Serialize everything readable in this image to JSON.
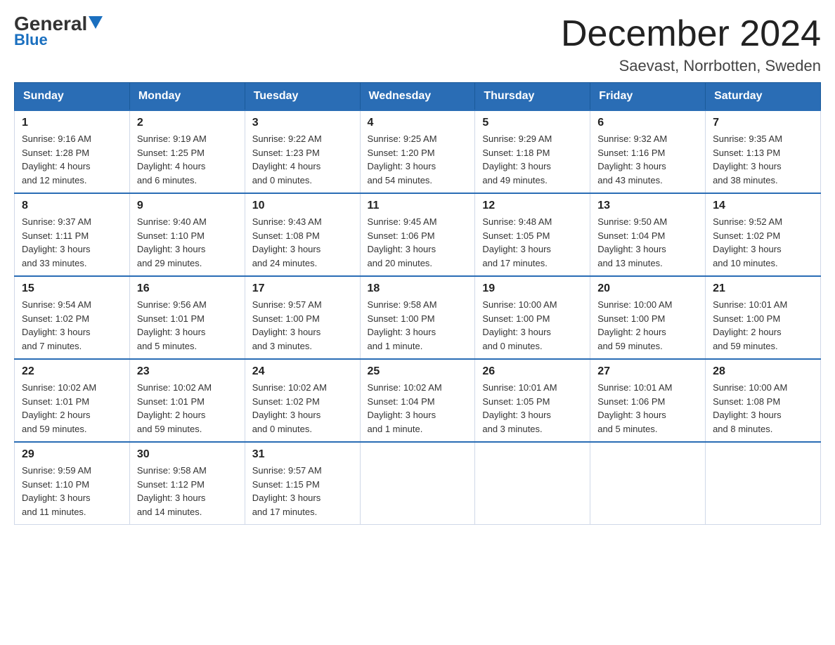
{
  "logo": {
    "general": "General",
    "blue": "Blue"
  },
  "title": "December 2024",
  "subtitle": "Saevast, Norrbotten, Sweden",
  "weekdays": [
    "Sunday",
    "Monday",
    "Tuesday",
    "Wednesday",
    "Thursday",
    "Friday",
    "Saturday"
  ],
  "weeks": [
    [
      {
        "day": "1",
        "info": "Sunrise: 9:16 AM\nSunset: 1:28 PM\nDaylight: 4 hours\nand 12 minutes."
      },
      {
        "day": "2",
        "info": "Sunrise: 9:19 AM\nSunset: 1:25 PM\nDaylight: 4 hours\nand 6 minutes."
      },
      {
        "day": "3",
        "info": "Sunrise: 9:22 AM\nSunset: 1:23 PM\nDaylight: 4 hours\nand 0 minutes."
      },
      {
        "day": "4",
        "info": "Sunrise: 9:25 AM\nSunset: 1:20 PM\nDaylight: 3 hours\nand 54 minutes."
      },
      {
        "day": "5",
        "info": "Sunrise: 9:29 AM\nSunset: 1:18 PM\nDaylight: 3 hours\nand 49 minutes."
      },
      {
        "day": "6",
        "info": "Sunrise: 9:32 AM\nSunset: 1:16 PM\nDaylight: 3 hours\nand 43 minutes."
      },
      {
        "day": "7",
        "info": "Sunrise: 9:35 AM\nSunset: 1:13 PM\nDaylight: 3 hours\nand 38 minutes."
      }
    ],
    [
      {
        "day": "8",
        "info": "Sunrise: 9:37 AM\nSunset: 1:11 PM\nDaylight: 3 hours\nand 33 minutes."
      },
      {
        "day": "9",
        "info": "Sunrise: 9:40 AM\nSunset: 1:10 PM\nDaylight: 3 hours\nand 29 minutes."
      },
      {
        "day": "10",
        "info": "Sunrise: 9:43 AM\nSunset: 1:08 PM\nDaylight: 3 hours\nand 24 minutes."
      },
      {
        "day": "11",
        "info": "Sunrise: 9:45 AM\nSunset: 1:06 PM\nDaylight: 3 hours\nand 20 minutes."
      },
      {
        "day": "12",
        "info": "Sunrise: 9:48 AM\nSunset: 1:05 PM\nDaylight: 3 hours\nand 17 minutes."
      },
      {
        "day": "13",
        "info": "Sunrise: 9:50 AM\nSunset: 1:04 PM\nDaylight: 3 hours\nand 13 minutes."
      },
      {
        "day": "14",
        "info": "Sunrise: 9:52 AM\nSunset: 1:02 PM\nDaylight: 3 hours\nand 10 minutes."
      }
    ],
    [
      {
        "day": "15",
        "info": "Sunrise: 9:54 AM\nSunset: 1:02 PM\nDaylight: 3 hours\nand 7 minutes."
      },
      {
        "day": "16",
        "info": "Sunrise: 9:56 AM\nSunset: 1:01 PM\nDaylight: 3 hours\nand 5 minutes."
      },
      {
        "day": "17",
        "info": "Sunrise: 9:57 AM\nSunset: 1:00 PM\nDaylight: 3 hours\nand 3 minutes."
      },
      {
        "day": "18",
        "info": "Sunrise: 9:58 AM\nSunset: 1:00 PM\nDaylight: 3 hours\nand 1 minute."
      },
      {
        "day": "19",
        "info": "Sunrise: 10:00 AM\nSunset: 1:00 PM\nDaylight: 3 hours\nand 0 minutes."
      },
      {
        "day": "20",
        "info": "Sunrise: 10:00 AM\nSunset: 1:00 PM\nDaylight: 2 hours\nand 59 minutes."
      },
      {
        "day": "21",
        "info": "Sunrise: 10:01 AM\nSunset: 1:00 PM\nDaylight: 2 hours\nand 59 minutes."
      }
    ],
    [
      {
        "day": "22",
        "info": "Sunrise: 10:02 AM\nSunset: 1:01 PM\nDaylight: 2 hours\nand 59 minutes."
      },
      {
        "day": "23",
        "info": "Sunrise: 10:02 AM\nSunset: 1:01 PM\nDaylight: 2 hours\nand 59 minutes."
      },
      {
        "day": "24",
        "info": "Sunrise: 10:02 AM\nSunset: 1:02 PM\nDaylight: 3 hours\nand 0 minutes."
      },
      {
        "day": "25",
        "info": "Sunrise: 10:02 AM\nSunset: 1:04 PM\nDaylight: 3 hours\nand 1 minute."
      },
      {
        "day": "26",
        "info": "Sunrise: 10:01 AM\nSunset: 1:05 PM\nDaylight: 3 hours\nand 3 minutes."
      },
      {
        "day": "27",
        "info": "Sunrise: 10:01 AM\nSunset: 1:06 PM\nDaylight: 3 hours\nand 5 minutes."
      },
      {
        "day": "28",
        "info": "Sunrise: 10:00 AM\nSunset: 1:08 PM\nDaylight: 3 hours\nand 8 minutes."
      }
    ],
    [
      {
        "day": "29",
        "info": "Sunrise: 9:59 AM\nSunset: 1:10 PM\nDaylight: 3 hours\nand 11 minutes."
      },
      {
        "day": "30",
        "info": "Sunrise: 9:58 AM\nSunset: 1:12 PM\nDaylight: 3 hours\nand 14 minutes."
      },
      {
        "day": "31",
        "info": "Sunrise: 9:57 AM\nSunset: 1:15 PM\nDaylight: 3 hours\nand 17 minutes."
      },
      null,
      null,
      null,
      null
    ]
  ]
}
